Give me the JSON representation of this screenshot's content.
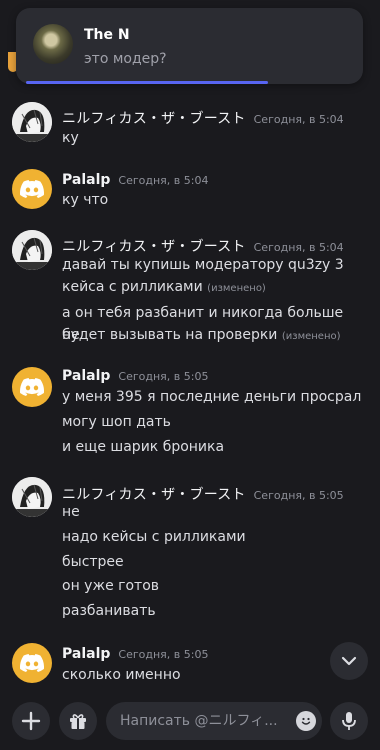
{
  "notification": {
    "name": "The N",
    "text": "это модер?"
  },
  "messages": [
    {
      "author": "ニルフィカス・ザ・ブースト",
      "time": "Сегодня, в 5:04",
      "lines": [
        "ку"
      ]
    },
    {
      "author": "Palalp",
      "time": "Сегодня, в 5:04",
      "lines": [
        "ку что"
      ]
    },
    {
      "author": "ニルフィカス・ザ・ブースト",
      "time": "Сегодня, в 5:04",
      "lines": [
        "давай ты купишь модератору qu3zy 3",
        "кейса с рилликами",
        "а он тебя разбанит и никогда больше не",
        "будет вызывать на проверки"
      ],
      "edited": "(изменено)"
    },
    {
      "author": "Palalp",
      "time": "Сегодня, в 5:05",
      "lines": [
        "у меня 395 я последние деньги просрал",
        "могу шоп дать",
        "и еще шарик броника"
      ]
    },
    {
      "author": "ニルフィカス・ザ・ブースト",
      "time": "Сегодня, в 5:05",
      "lines": [
        "не",
        "надо кейсы с рилликами",
        "быстрее",
        "он уже готов",
        "разбанивать"
      ]
    },
    {
      "author": "Palalp",
      "time": "Сегодня, в 5:05",
      "lines": [
        "сколько именно"
      ]
    }
  ],
  "composer": {
    "placeholder": "Написать @ニルフィ..."
  },
  "icons": {
    "add": "plus-icon",
    "gift": "gift-icon",
    "emoji": "emoji-icon",
    "mic": "microphone-icon",
    "scroll": "chevron-down-icon",
    "discord": "discord-logo-icon"
  },
  "colors": {
    "accent": "#5865f2",
    "discord_avatar": "#f0b232",
    "background": "#1a1a1e"
  }
}
